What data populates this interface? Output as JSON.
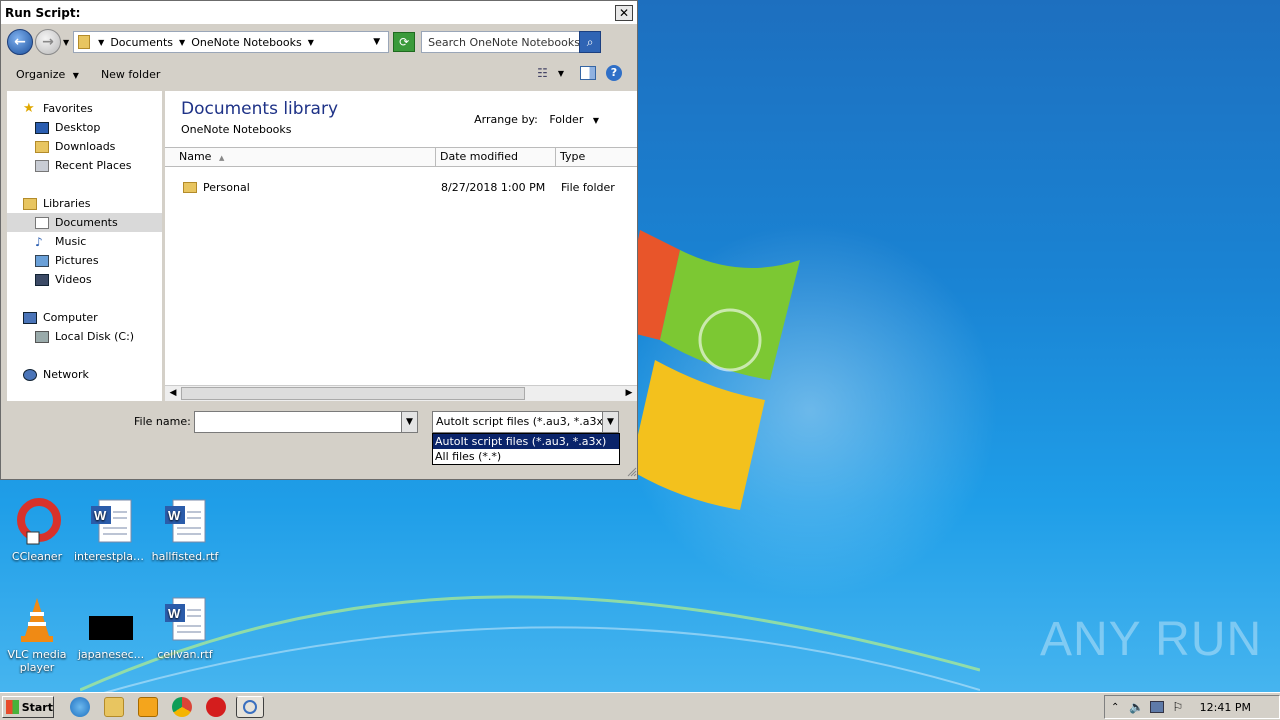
{
  "dialog": {
    "title": "Run Script:",
    "close_glyph": "✕",
    "address": {
      "crumbs": [
        "Documents",
        "OneNote Notebooks"
      ],
      "search_placeholder": "Search OneNote Notebooks"
    },
    "toolbar": {
      "organize": "Organize",
      "new_folder": "New folder",
      "help": "?"
    },
    "nav": {
      "favorites": "Favorites",
      "favorites_items": [
        "Desktop",
        "Downloads",
        "Recent Places"
      ],
      "libraries": "Libraries",
      "libraries_items": [
        "Documents",
        "Music",
        "Pictures",
        "Videos"
      ],
      "computer": "Computer",
      "computer_items": [
        "Local Disk (C:)"
      ],
      "network": "Network"
    },
    "content": {
      "library_title": "Documents library",
      "library_sub": "OneNote Notebooks",
      "arrange_label": "Arrange by:",
      "arrange_value": "Folder",
      "columns": [
        "Name",
        "Date modified",
        "Type"
      ],
      "rows": [
        {
          "name": "Personal",
          "date": "8/27/2018 1:00 PM",
          "type": "File folder"
        }
      ]
    },
    "bottom": {
      "file_name_label": "File name:",
      "file_name_value": "",
      "file_type_selected": "AutoIt script files (*.au3, *.a3x)",
      "file_type_options": [
        "AutoIt script files (*.au3, *.a3x)",
        "All files (*.*)"
      ]
    }
  },
  "desktop": {
    "icons": [
      {
        "label": "CCleaner"
      },
      {
        "label": "interestplan..."
      },
      {
        "label": "hallfisted.rtf"
      },
      {
        "label": "VLC media player"
      },
      {
        "label": "japanesec..."
      },
      {
        "label": "cellvan.rtf"
      }
    ],
    "watermark_text": "ANY RUN"
  },
  "taskbar": {
    "start_label": "Start",
    "clock": "12:41 PM"
  }
}
